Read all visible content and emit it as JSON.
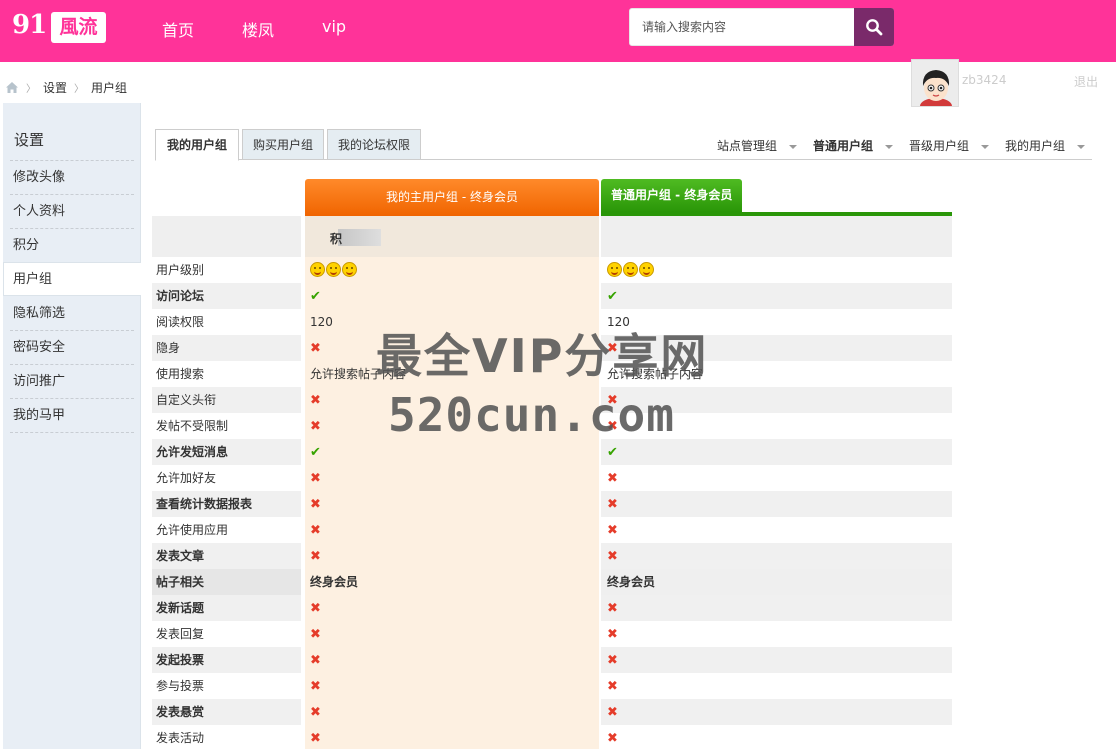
{
  "header": {
    "logo_num": "91",
    "logo_text": "風流",
    "nav": [
      "首页",
      "楼凤",
      "vip"
    ],
    "search_placeholder": "请输入搜索内容",
    "brand_color": "#ff3399"
  },
  "breadcrumb": [
    "设置",
    "用户组"
  ],
  "user": {
    "name": "zb3424",
    "logout": "退出"
  },
  "sidebar": {
    "title": "设置",
    "items": [
      "修改头像",
      "个人资料",
      "积分",
      "用户组",
      "隐私筛选",
      "密码安全",
      "访问推广",
      "我的马甲"
    ],
    "active": "用户组"
  },
  "tabs": [
    "我的用户组",
    "购买用户组",
    "我的论坛权限"
  ],
  "filters": [
    "站点管理组",
    "普通用户组",
    "晋级用户组",
    "我的用户组"
  ],
  "columns": {
    "main": "我的主用户组 - 终身会员",
    "normal": "普通用户组 - 终身会员",
    "points_label": "积"
  },
  "rows": [
    {
      "label": "用户级别",
      "c1": "smile3",
      "c2": "smile3"
    },
    {
      "label": "访问论坛",
      "c1": "ok",
      "c2": "ok"
    },
    {
      "label": "阅读权限",
      "c1": "120",
      "c2": "120"
    },
    {
      "label": "隐身",
      "c1": "no",
      "c2": "no"
    },
    {
      "label": "使用搜索",
      "c1": "允许搜索帖子内容",
      "c2": "允许搜索帖子内容"
    },
    {
      "label": "自定义头衔",
      "c1": "no",
      "c2": "no"
    },
    {
      "label": "发帖不受限制",
      "c1": "no",
      "c2": "no"
    },
    {
      "label": "允许发短消息",
      "c1": "ok",
      "c2": "ok"
    },
    {
      "label": "允许加好友",
      "c1": "no",
      "c2": "no"
    },
    {
      "label": "查看统计数据报表",
      "c1": "no",
      "c2": "no"
    },
    {
      "label": "允许使用应用",
      "c1": "no",
      "c2": "no"
    },
    {
      "label": "发表文章",
      "c1": "no",
      "c2": "no"
    },
    {
      "label": "帖子相关",
      "c1": "终身会员",
      "c2": "终身会员",
      "section": true
    },
    {
      "label": "发新话题",
      "c1": "no",
      "c2": "no"
    },
    {
      "label": "发表回复",
      "c1": "no",
      "c2": "no"
    },
    {
      "label": "发起投票",
      "c1": "no",
      "c2": "no"
    },
    {
      "label": "参与投票",
      "c1": "no",
      "c2": "no"
    },
    {
      "label": "发表悬赏",
      "c1": "no",
      "c2": "no"
    },
    {
      "label": "发表活动",
      "c1": "no",
      "c2": "no"
    }
  ],
  "watermark": {
    "line1": "最全VIP分享网",
    "line2": "520cun.com"
  }
}
